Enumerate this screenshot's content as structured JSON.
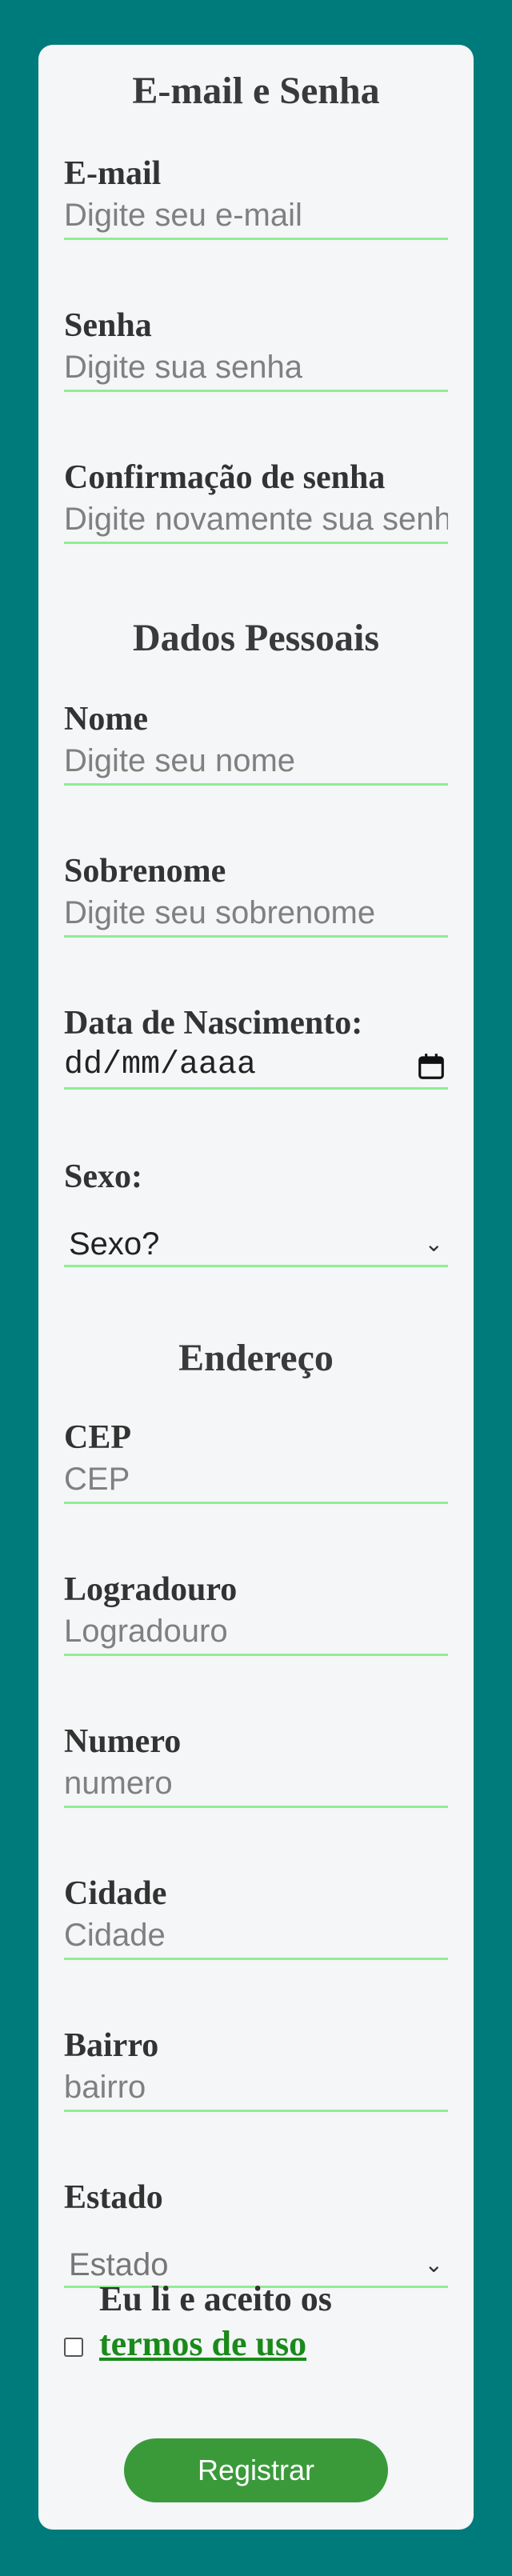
{
  "sections": {
    "credentials": "E-mail e Senha",
    "personal": "Dados Pessoais",
    "address": "Endereço"
  },
  "fields": {
    "email": {
      "label": "E-mail",
      "placeholder": "Digite seu e-mail"
    },
    "password": {
      "label": "Senha",
      "placeholder": "Digite sua senha"
    },
    "password_confirm": {
      "label": "Confirmação de senha",
      "placeholder": "Digite novamente sua senha"
    },
    "first_name": {
      "label": "Nome",
      "placeholder": "Digite seu nome"
    },
    "last_name": {
      "label": "Sobrenome",
      "placeholder": "Digite seu sobrenome"
    },
    "birth_date": {
      "label": "Data de Nascimento:",
      "value": "dd/mm/aaaa"
    },
    "sex": {
      "label": "Sexo:",
      "value": "Sexo?"
    },
    "cep": {
      "label": "CEP",
      "placeholder": "CEP"
    },
    "street": {
      "label": "Logradouro",
      "placeholder": "Logradouro"
    },
    "number": {
      "label": "Numero",
      "placeholder": "numero"
    },
    "city": {
      "label": "Cidade",
      "placeholder": "Cidade"
    },
    "neighborhood": {
      "label": "Bairro",
      "placeholder": "bairro"
    },
    "state": {
      "label": "Estado",
      "value": "Estado"
    }
  },
  "terms": {
    "prefix": "Eu li e aceito os",
    "link": "termos de uso"
  },
  "register_button": "Registrar"
}
